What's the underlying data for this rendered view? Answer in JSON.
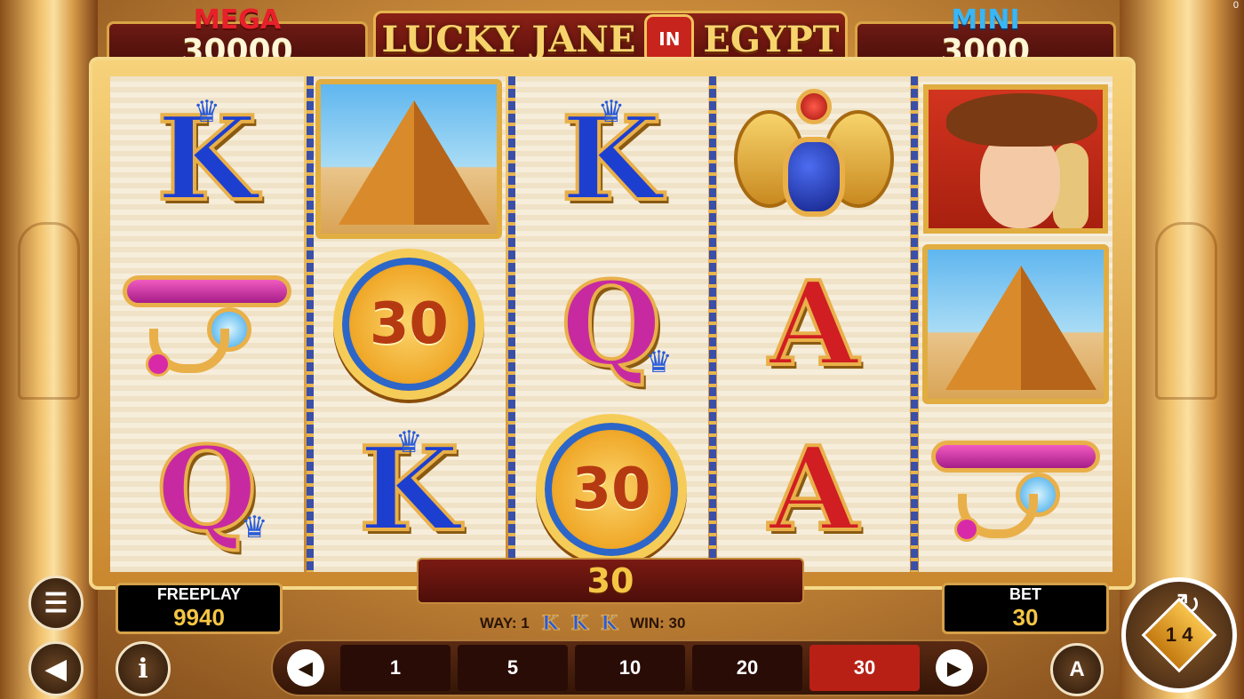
{
  "jackpots": {
    "mega": {
      "label": "MEGA",
      "value": "30000"
    },
    "mini": {
      "label": "MINI",
      "value": "3000"
    }
  },
  "logo": {
    "part1": "LUCKY JANE",
    "in": "IN",
    "part2": "EGYPT"
  },
  "reels": [
    [
      "K",
      "eye",
      "Q"
    ],
    [
      "pyramid",
      "coin-30",
      "K"
    ],
    [
      "K",
      "Q",
      "coin-30"
    ],
    [
      "scarab",
      "A",
      "A"
    ],
    [
      "jane",
      "pyramid",
      "eye"
    ]
  ],
  "coin_value": "30",
  "win_display": "30",
  "way_info": {
    "way_label": "WAY: 1",
    "win_label": "WIN: 30",
    "symbol": "K"
  },
  "freeplay": {
    "label": "FREEPLAY",
    "value": "9940"
  },
  "bet": {
    "label": "BET",
    "value": "30"
  },
  "bet_options": [
    "1",
    "5",
    "10",
    "20",
    "30"
  ],
  "selected_bet": "30",
  "spin_label": "1 4",
  "auto_label": "A",
  "corner_counter": "0",
  "colors": {
    "accent_red": "#b82016",
    "gold": "#f5c644",
    "frame_gold": "#e1ad40"
  }
}
